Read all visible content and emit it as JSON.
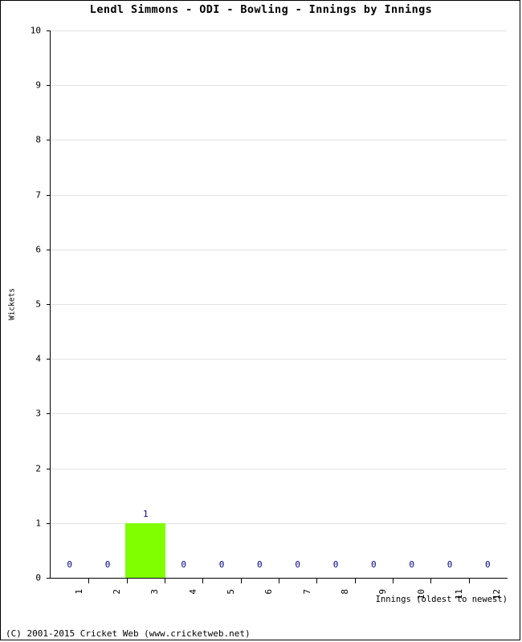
{
  "chart_data": {
    "type": "bar",
    "title": "Lendl Simmons - ODI - Bowling - Innings by Innings",
    "xlabel": "Innings (oldest to newest)",
    "ylabel": "Wickets",
    "categories": [
      "1",
      "2",
      "3",
      "4",
      "5",
      "6",
      "7",
      "8",
      "9",
      "10",
      "11",
      "12"
    ],
    "values": [
      0,
      0,
      1,
      0,
      0,
      0,
      0,
      0,
      0,
      0,
      0,
      0
    ],
    "point_labels": [
      "0",
      "0",
      "1",
      "0",
      "0",
      "0",
      "0",
      "0",
      "0",
      "0",
      "0",
      "0"
    ],
    "ylim": [
      0,
      10
    ],
    "y_ticks": [
      "0",
      "1",
      "2",
      "3",
      "4",
      "5",
      "6",
      "7",
      "8",
      "9",
      "10"
    ],
    "grid": true,
    "legend": false,
    "bar_color": "#80ff00",
    "label_color": "#00008b",
    "gridline_color": "#e2e2e2",
    "axis_color": "#000000"
  },
  "footer": {
    "copyright": "(C) 2001-2015 Cricket Web (www.cricketweb.net)"
  }
}
